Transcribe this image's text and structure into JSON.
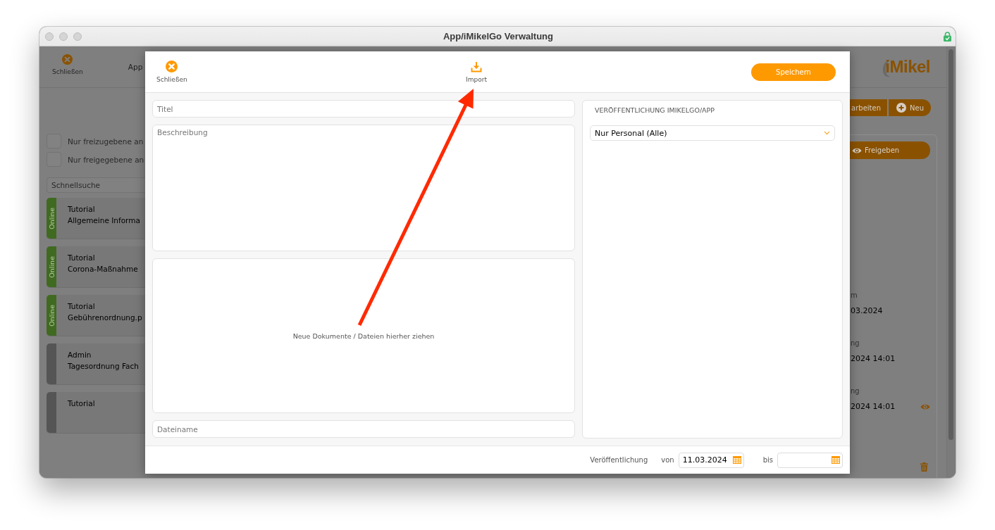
{
  "window": {
    "title": "App/iMikelGo Verwaltung"
  },
  "background_app": {
    "toolbar": {
      "close_label": "Schließen",
      "title": "App",
      "logo": "iMikel"
    },
    "filters": [
      {
        "label": "Nur freizugebene an",
        "checked": false
      },
      {
        "label": "Nur freigegebene an",
        "checked": false
      }
    ],
    "search": {
      "placeholder": "Schnellsuche"
    },
    "items": [
      {
        "status": "Online",
        "published": true,
        "category": "Tutorial",
        "name": "Allgemeine Informa"
      },
      {
        "status": "Online",
        "published": true,
        "category": "Tutorial",
        "name": "Corona-Maßnahme"
      },
      {
        "status": "Online",
        "published": true,
        "category": "Tutorial",
        "name": "Gebührenordnung.p"
      },
      {
        "published": false,
        "category": "Admin",
        "name": "Tagesordnung Fach"
      },
      {
        "published": false,
        "category": "Tutorial"
      }
    ],
    "actions": [
      {
        "kind": "edit",
        "label": "arbeiten"
      },
      {
        "kind": "new",
        "label": "Neu"
      }
    ],
    "details_panel": {
      "release_button": "Freigeben",
      "fields": [
        {
          "kind": "plain",
          "label": "m",
          "value": "03.2024"
        },
        {
          "kind": "plain",
          "label": "ng",
          "value": "2024 14:01"
        },
        {
          "kind": "eye",
          "label": "ng",
          "value": "2024 14:01"
        }
      ]
    }
  },
  "dialog": {
    "toolbar": [
      {
        "kind": "close",
        "label": "Schließen"
      },
      {
        "kind": "import",
        "label": "Import"
      }
    ],
    "save_button": "Speichern",
    "title_field": {
      "placeholder": "Titel"
    },
    "description_field": {
      "placeholder": "Beschreibung"
    },
    "drop_zone": {
      "hint": "Neue Dokumente / Dateien hierher ziehen"
    },
    "filename_field": {
      "placeholder": "Dateiname"
    },
    "publication": {
      "heading": "VERÖFFENTLICHUNG IMIKELGO/APP",
      "audience": "Nur Personal (Alle)"
    },
    "footer": {
      "label": "Veröffentlichung",
      "from_label": "von",
      "from_value": "11.03.2024",
      "to_label": "bis"
    }
  }
}
